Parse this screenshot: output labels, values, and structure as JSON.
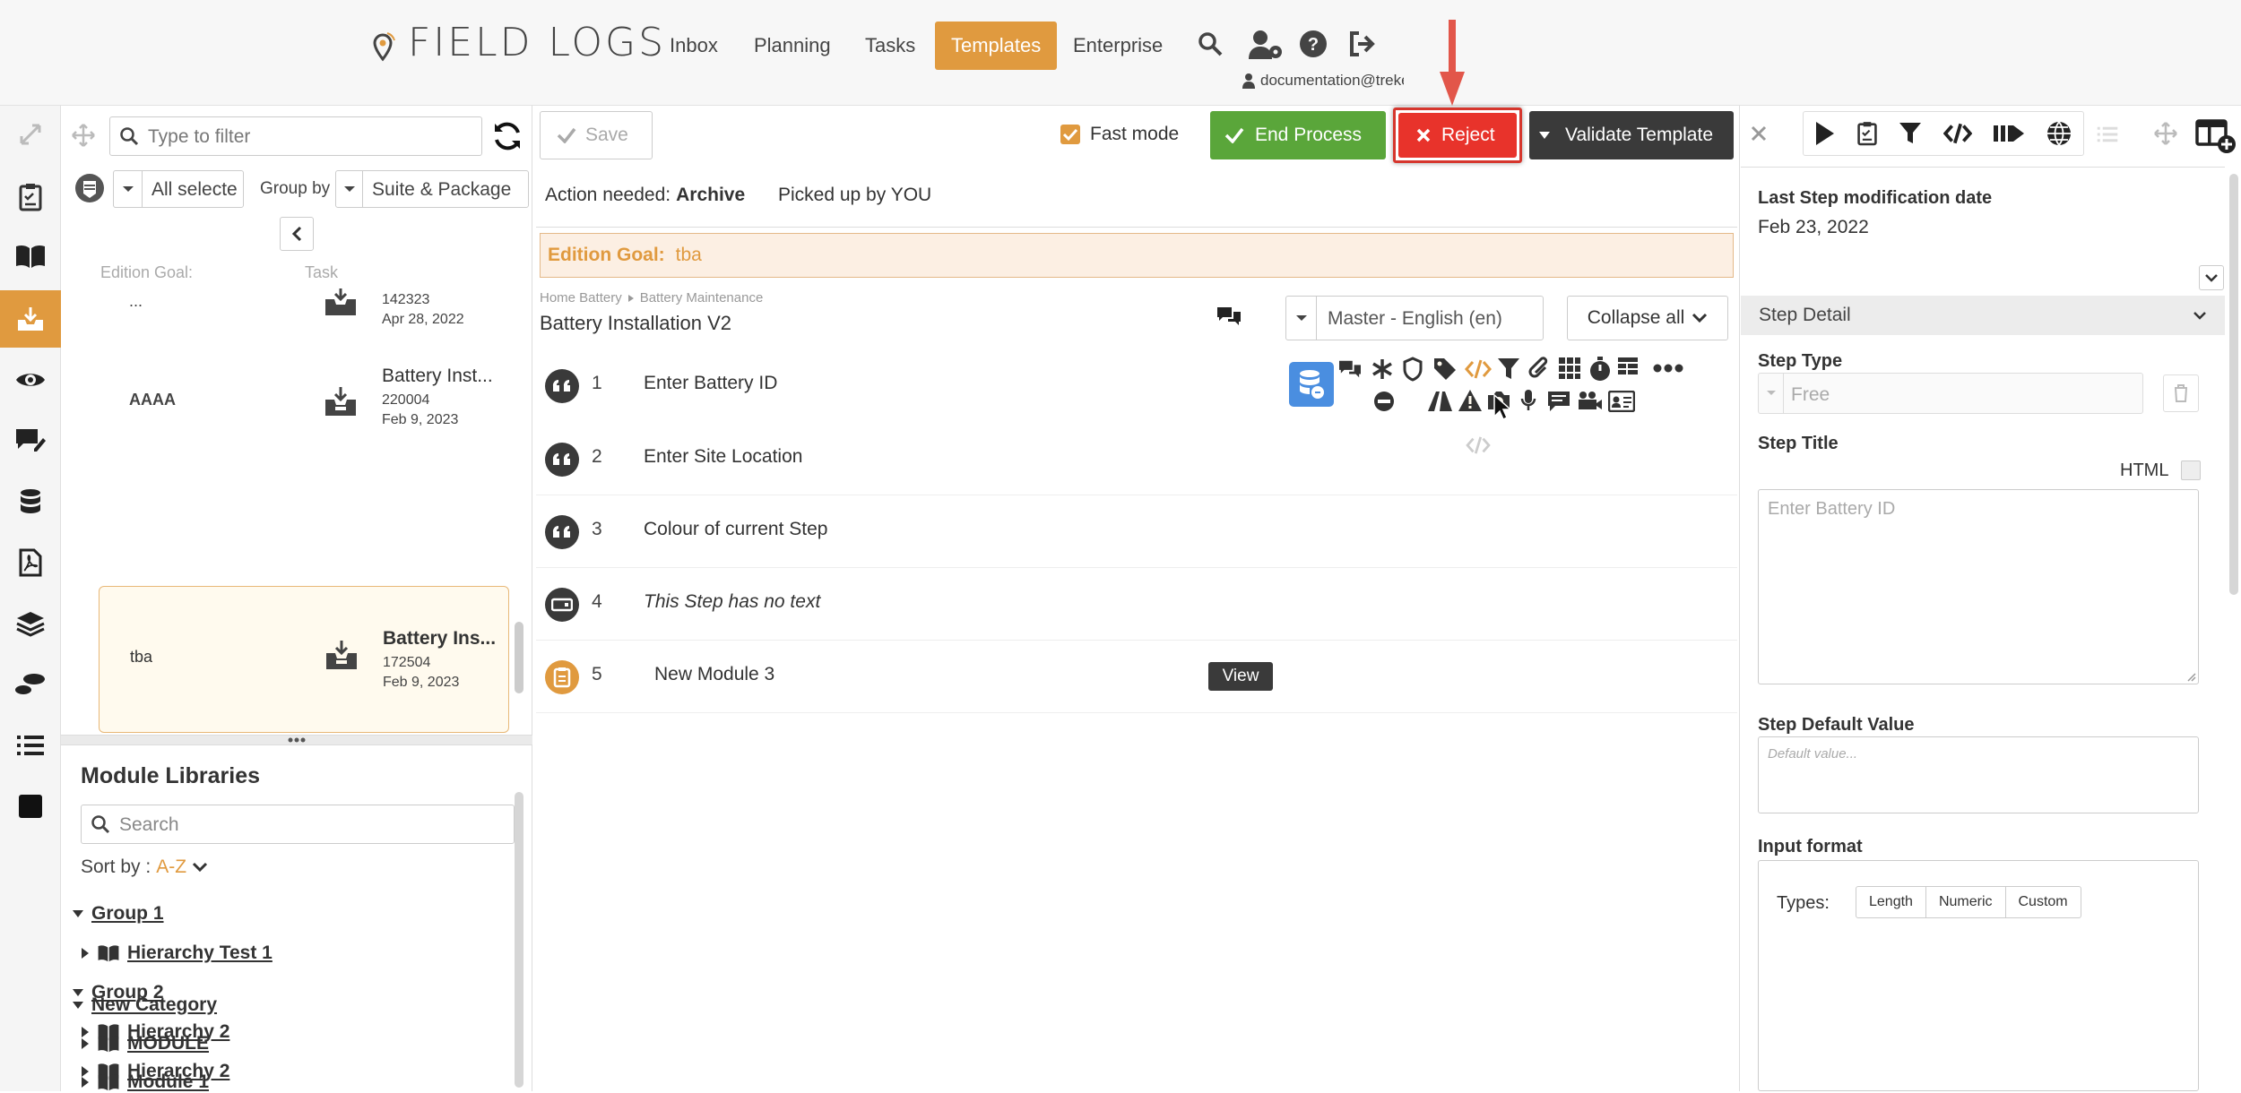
{
  "app": {
    "logo_text": "FIELD LOGS"
  },
  "nav": {
    "items": [
      "Inbox",
      "Planning",
      "Tasks",
      "Templates",
      "Enterprise"
    ],
    "active": "Templates",
    "user_email": "documentation@trekea.com"
  },
  "taskpanel": {
    "filter_placeholder": "Type to filter",
    "select_all": "All selecte",
    "group_by_label": "Group by",
    "group_by_value": "Suite & Package",
    "col_edition_goal": "Edition Goal:",
    "col_task": "Task",
    "cards": [
      {
        "goal": "...",
        "title": "",
        "id": "142323",
        "date": "Apr 28, 2022"
      },
      {
        "goal": "AAAA",
        "title": "Battery Inst...",
        "id": "220004",
        "date": "Feb 9, 2023"
      },
      {
        "goal": "tba",
        "title": "Battery Ins...",
        "id": "172504",
        "date": "Feb 9, 2023"
      }
    ]
  },
  "modules": {
    "title": "Module Libraries",
    "search_placeholder": "Search",
    "sort_label": "Sort by :",
    "sort_value": "A-Z",
    "tree": [
      {
        "label": "Group 1",
        "level": 0,
        "expanded": true
      },
      {
        "label": "Hierarchy Test 1",
        "level": 1
      },
      {
        "label": "Group 2",
        "level": 0,
        "expanded": true
      },
      {
        "label": "Hierarchy 2",
        "level": 1
      },
      {
        "label": "Hierarchy 2",
        "level": 1
      },
      {
        "label": "New Category",
        "level": 0,
        "expanded": true
      },
      {
        "label": "MODULE",
        "level": 1
      },
      {
        "label": "Module 1",
        "level": 1
      }
    ]
  },
  "toolbar": {
    "save_label": "Save",
    "fast_mode_label": "Fast mode",
    "end_process_label": "End Process",
    "reject_label": "Reject",
    "validate_label": "Validate Template"
  },
  "status": {
    "action_needed_label": "Action needed:",
    "action_needed_value": "Archive",
    "picked_up": "Picked up by YOU",
    "edition_goal_label": "Edition Goal:",
    "edition_goal_value": "tba"
  },
  "template": {
    "breadcrumb": [
      "Home Battery",
      "Battery Maintenance"
    ],
    "title": "Battery Installation V2",
    "language": "Master - English (en)",
    "collapse_all": "Collapse all",
    "view_label": "View",
    "steps": [
      {
        "num": "1",
        "text": "Enter Battery ID",
        "icon": "quote-icon"
      },
      {
        "num": "2",
        "text": "Enter Site Location",
        "icon": "quote-icon"
      },
      {
        "num": "3",
        "text": "Colour of current Step",
        "icon": "quote-icon"
      },
      {
        "num": "4",
        "text": "This Step has no text",
        "icon": "input-box-icon"
      },
      {
        "num": "5",
        "text": "New Module 3",
        "icon": "module-icon"
      }
    ]
  },
  "detail": {
    "last_mod_label": "Last Step modification date",
    "last_mod_value": "Feb 23, 2022",
    "step_detail_label": "Step Detail",
    "step_type_label": "Step Type",
    "step_type_value": "Free",
    "step_title_label": "Step Title",
    "html_label": "HTML",
    "step_title_placeholder": "Enter Battery ID",
    "default_value_label": "Step Default Value",
    "default_value_placeholder": "Default value...",
    "input_format_label": "Input format",
    "types_label": "Types:",
    "types": [
      "Length",
      "Numeric",
      "Custom"
    ]
  },
  "colors": {
    "accent": "#e09a3f",
    "reject": "#e8332b",
    "end_process": "#5aa63a",
    "dark": "#3a3a3a"
  }
}
